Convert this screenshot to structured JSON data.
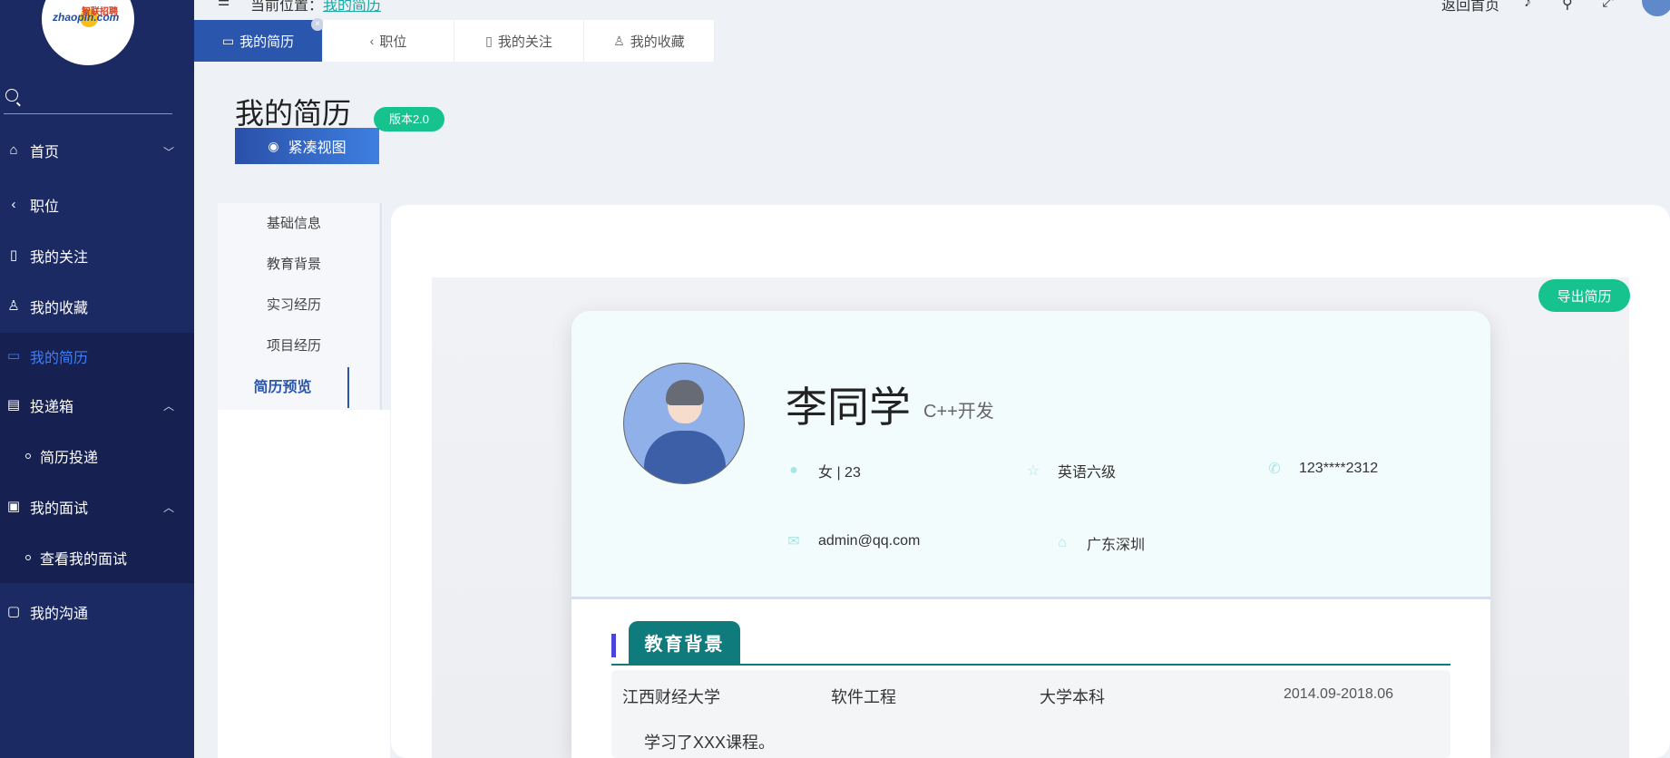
{
  "sidebar": {
    "logo_text": "zhaopin.com",
    "logo_cn": "智联招聘",
    "search_placeholder": "",
    "items": [
      {
        "label": "首页",
        "icon": "home-icon"
      },
      {
        "label": "职位",
        "icon": "chevron-left-icon"
      },
      {
        "label": "我的关注",
        "icon": "mouse-icon"
      },
      {
        "label": "我的收藏",
        "icon": "user-icon"
      },
      {
        "label": "我的简历",
        "icon": "folder-icon"
      },
      {
        "label": "投递箱",
        "icon": "inbox-icon"
      },
      {
        "label": "简历投递",
        "icon": "bullet"
      },
      {
        "label": "我的面试",
        "icon": "briefcase-icon"
      },
      {
        "label": "查看我的面试",
        "icon": "bullet"
      },
      {
        "label": "我的沟通",
        "icon": "chat-icon"
      }
    ]
  },
  "topbar": {
    "crumb_prefix": "当前位置：",
    "crumb_link": "我的简历",
    "back_home": "返回首页"
  },
  "tabs": [
    {
      "label": "我的简历",
      "icon": "folder-icon"
    },
    {
      "label": "职位",
      "icon": "chevron-left-icon"
    },
    {
      "label": "我的关注",
      "icon": "mouse-icon"
    },
    {
      "label": "我的收藏",
      "icon": "user-icon"
    }
  ],
  "page": {
    "title": "我的简历",
    "version": "版本2.0",
    "compact_view": "紧凑视图",
    "export": "导出简历"
  },
  "steps": [
    "基础信息",
    "教育背景",
    "实习经历",
    "项目经历",
    "简历预览"
  ],
  "resume": {
    "name": "李同学",
    "role": "C++开发",
    "gender_age": "女 | 23",
    "english": "英语六级",
    "phone": "123****2312",
    "email": "admin@qq.com",
    "location": "广东深圳",
    "section_title": "教育背景",
    "education": {
      "school": "江西财经大学",
      "major": "软件工程",
      "degree": "大学本科",
      "period": "2014.09-2018.06",
      "description": "学习了XXX课程。"
    }
  },
  "colors": {
    "sidebar": "#1c2a63",
    "primary": "#2b56ad",
    "accent_green": "#16c28e",
    "section_teal": "#0f7b7d"
  }
}
